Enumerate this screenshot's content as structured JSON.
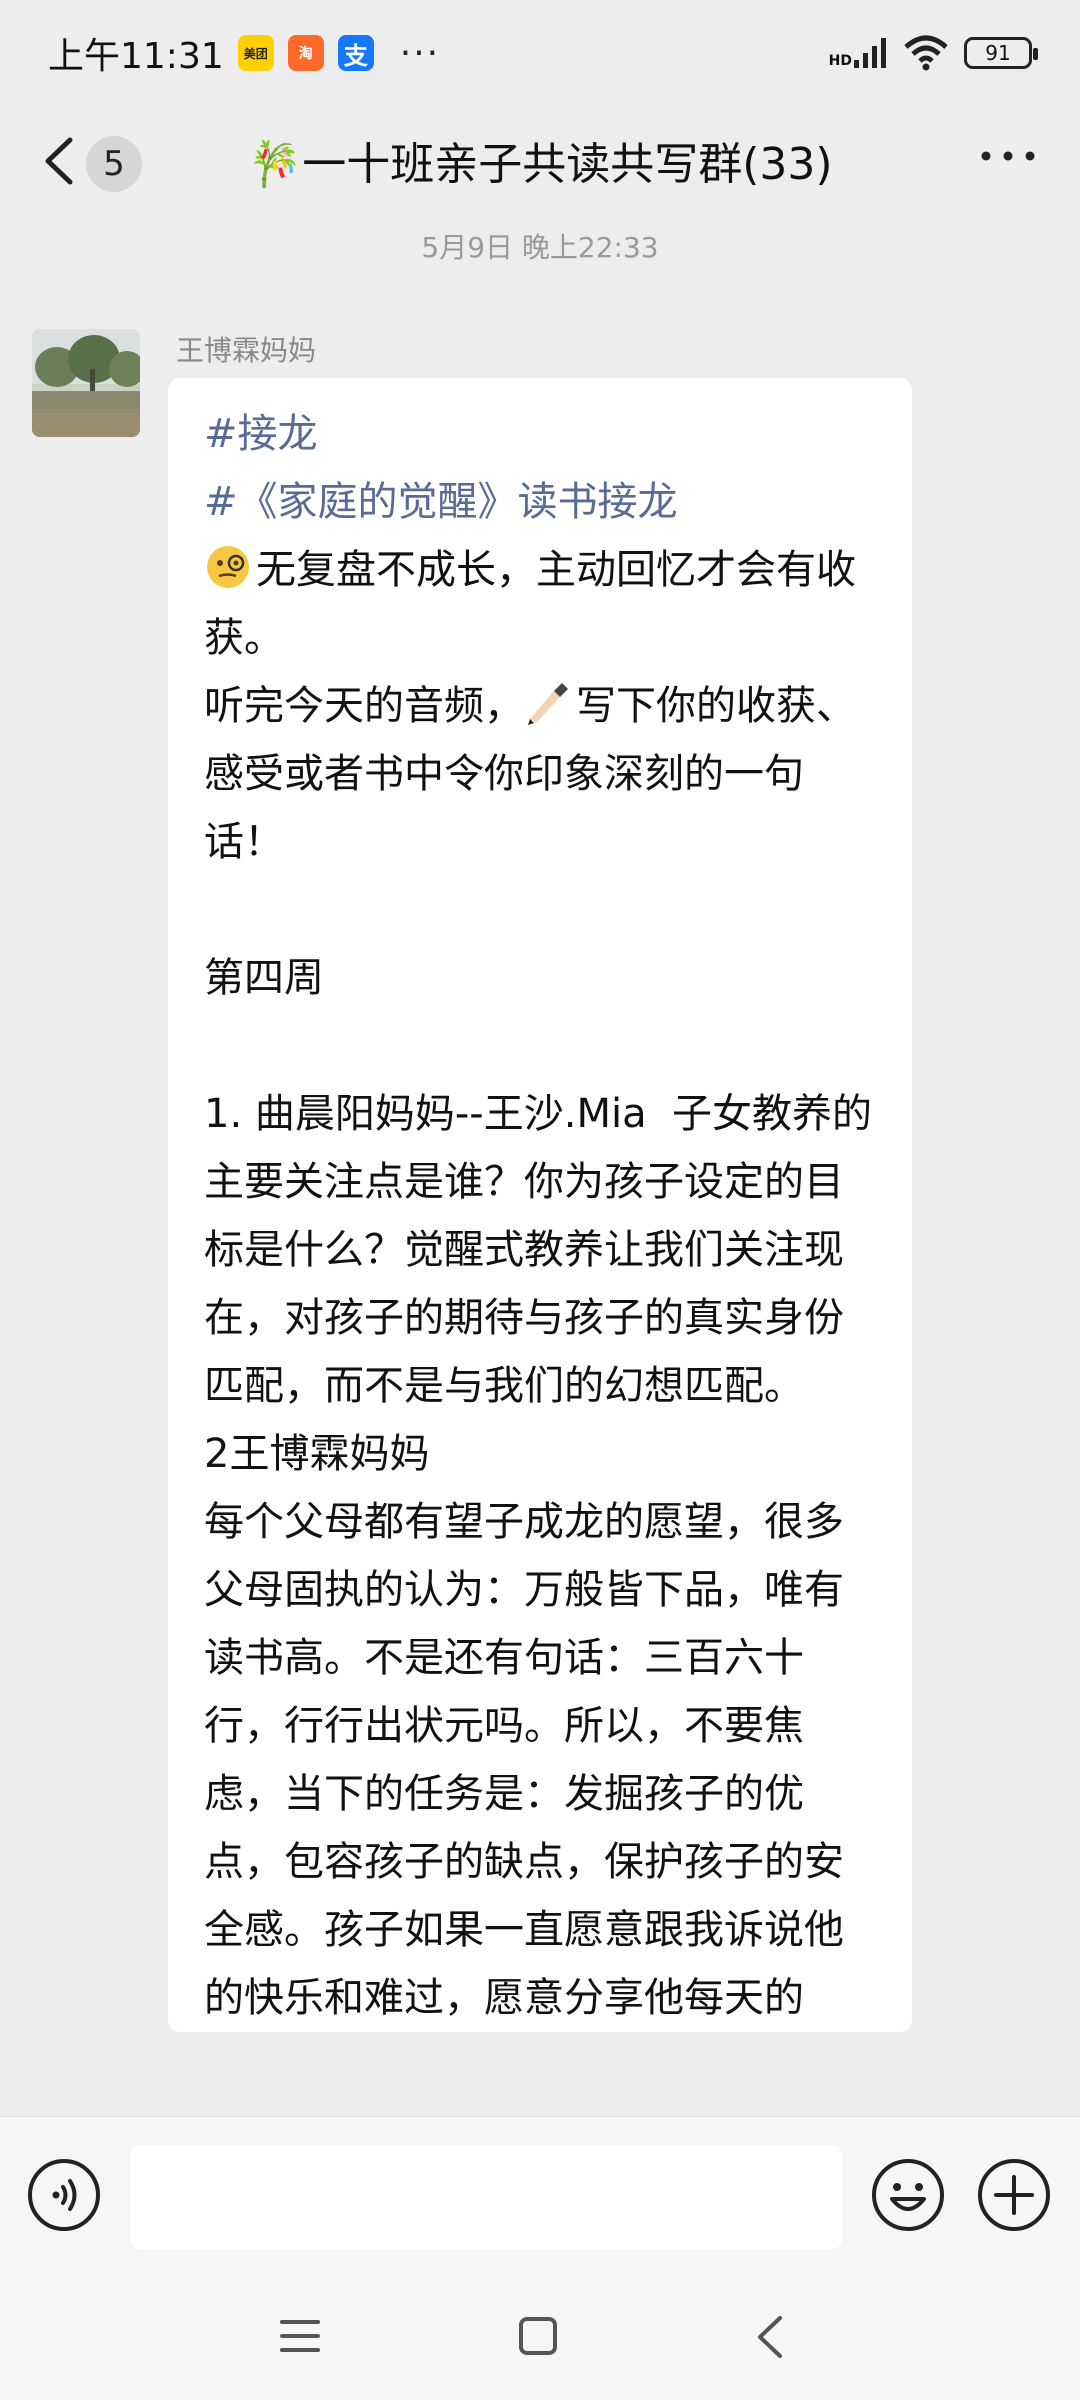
{
  "status_bar": {
    "time": "上午11:31",
    "apps": [
      {
        "name": "meituan-icon",
        "label": "美团"
      },
      {
        "name": "taobao-icon",
        "label": "淘"
      },
      {
        "name": "alipay-icon",
        "label": "支"
      }
    ],
    "more": "···",
    "network": "HD",
    "battery": "91"
  },
  "header": {
    "unread_count": "5",
    "title": "🎋一十班亲子共读共写群(33)"
  },
  "chat": {
    "timestamp": "5月9日 晚上22:33",
    "message": {
      "sender": "王博霖妈妈",
      "lines": [
        {
          "type": "tag",
          "text": "#接龙"
        },
        {
          "type": "tag",
          "text": "#《家庭的觉醒》读书接龙"
        },
        {
          "type": "text",
          "emoji": "🧐",
          "text": "无复盘不成长，主动回忆才会有收获。"
        },
        {
          "type": "text",
          "emoji_mid": "✍🏻",
          "text_before": "听完今天的音频，",
          "text": "写下你的收获、感受或者书中令你印象深刻的一句话！"
        },
        {
          "type": "blank",
          "text": ""
        },
        {
          "type": "text",
          "text": "第四周"
        },
        {
          "type": "blank",
          "text": ""
        },
        {
          "type": "text",
          "text": "1. 曲晨阳妈妈--王沙.Mia  子女教养的主要关注点是谁？你为孩子设定的目标是什么？觉醒式教养让我们关注现在，对孩子的期待与孩子的真实身份匹配，而不是与我们的幻想匹配。"
        },
        {
          "type": "text",
          "text": "2王博霖妈妈"
        },
        {
          "type": "text",
          "text": "每个父母都有望子成龙的愿望，很多父母固执的认为：万般皆下品，唯有读书高。不是还有句话：三百六十行，行行出状元吗。所以，不要焦虑，当下的任务是：发掘孩子的优点，包容孩子的缺点，保护孩子的安全感。孩子如果一直愿意跟我诉说他的快乐和难过，愿意分享他每天的"
        }
      ]
    }
  },
  "colors": {
    "background": "#ededed",
    "bubble": "#ffffff",
    "tag": "#576b95",
    "timestamp": "#999999"
  }
}
